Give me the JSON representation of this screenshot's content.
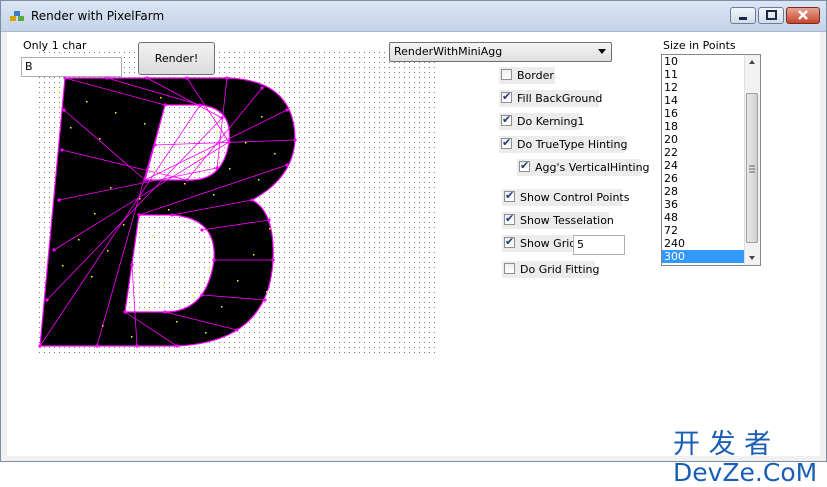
{
  "window": {
    "title": "Render with PixelFarm"
  },
  "char_input": {
    "label": "Only 1 char",
    "value": "B"
  },
  "render_button": {
    "label": "Render!"
  },
  "renderer_select": {
    "value": "RenderWithMiniAgg"
  },
  "checkboxes": {
    "border": {
      "label": "Border",
      "checked": false
    },
    "fill_background": {
      "label": "Fill BackGround",
      "checked": true
    },
    "kerning": {
      "label": "Do Kerning1",
      "checked": true
    },
    "truetype_hinting": {
      "label": "Do TrueType Hinting",
      "checked": true
    },
    "vertical_hinting": {
      "label": "Agg's VerticalHinting",
      "checked": true
    },
    "control_points": {
      "label": "Show Control Points",
      "checked": true
    },
    "tesselation": {
      "label": "Show Tesselation",
      "checked": true
    },
    "grid": {
      "label": "Show Grid",
      "checked": true
    },
    "grid_fitting": {
      "label": "Do Grid Fitting",
      "checked": false
    }
  },
  "grid_size": {
    "value": "5"
  },
  "size_list": {
    "label": "Size in Points",
    "items": [
      "10",
      "11",
      "12",
      "14",
      "16",
      "18",
      "20",
      "22",
      "24",
      "26",
      "28",
      "36",
      "48",
      "72",
      "240",
      "300"
    ],
    "selected": "300"
  },
  "glyph": {
    "character": "B",
    "fill_color": "#000000",
    "edge_color": "#ff00ff",
    "point_color": "#ffff00"
  },
  "watermark": {
    "chinese": "开 发 者",
    "latin": "DevZe.CoM",
    "color": "#1a5fb4"
  }
}
